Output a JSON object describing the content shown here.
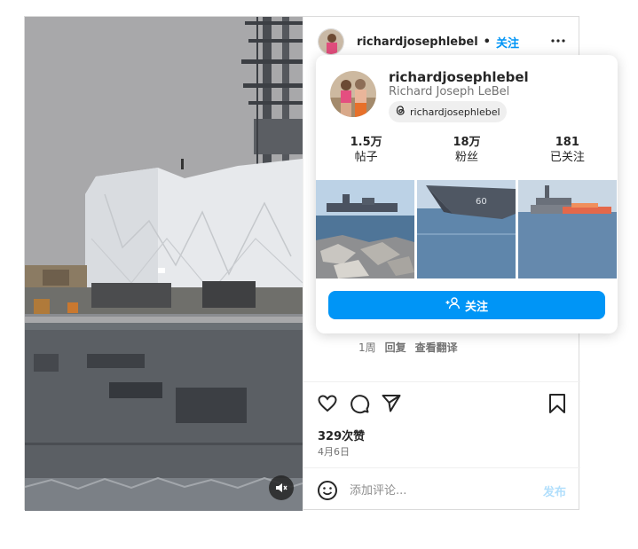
{
  "post": {
    "username": "richardjosephlebel",
    "separator": "•",
    "follow_label": "关注",
    "meta": {
      "time": "1周",
      "reply": "回复",
      "translate": "查看翻译"
    },
    "likes": "329次赞",
    "date": "4月6日",
    "comment": {
      "placeholder": "添加评论...",
      "post_label": "发布"
    }
  },
  "profile_card": {
    "username": "richardjosephlebel",
    "full_name": "Richard Joseph LeBel",
    "threads_handle": "richardjosephlebel",
    "stats": [
      {
        "value": "1.5万",
        "label": "帖子"
      },
      {
        "value": "18万",
        "label": "粉丝"
      },
      {
        "value": "181",
        "label": "已关注"
      }
    ],
    "follow_button": "关注"
  },
  "colors": {
    "accent": "#0095f6",
    "post_disabled": "#b2dffc",
    "muted_text": "#737373"
  },
  "icons": [
    "mute-icon",
    "more-icon",
    "heart-icon",
    "comment-icon",
    "share-icon",
    "bookmark-icon",
    "emoji-icon",
    "threads-icon",
    "add-person-icon"
  ]
}
